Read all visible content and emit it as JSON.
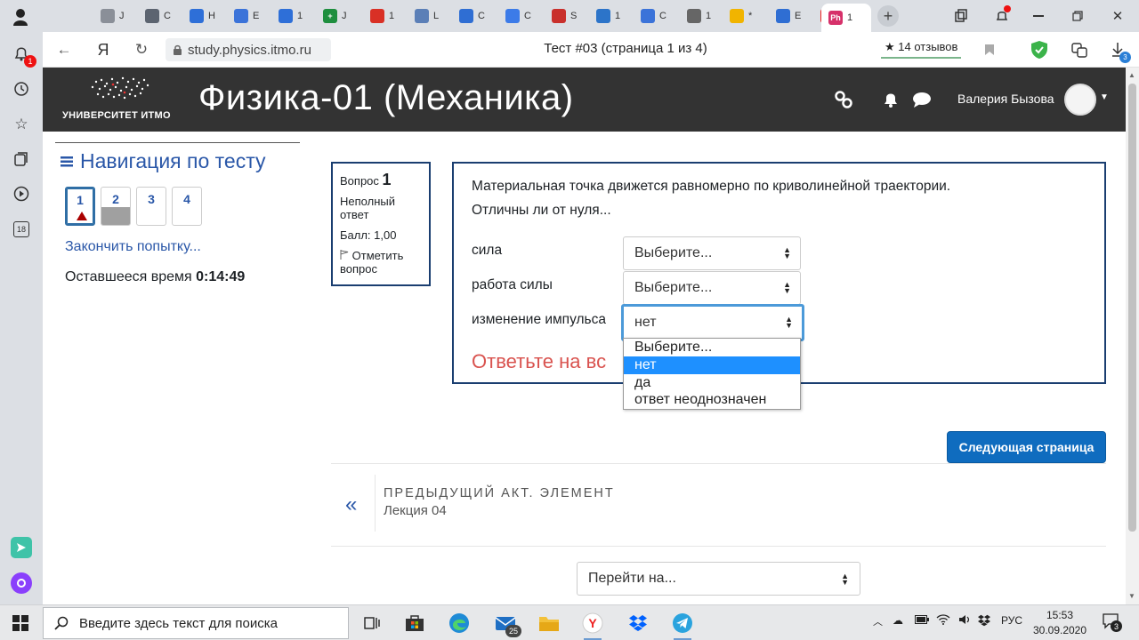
{
  "browser": {
    "tabs": [
      {
        "label": "",
        "fav_color": "#6b6b6b",
        "glyph": ""
      },
      {
        "label": "J",
        "fav_color": "#8a8f98",
        "glyph": ""
      },
      {
        "label": "C",
        "fav_color": "#5c6470",
        "glyph": ""
      },
      {
        "label": "H",
        "fav_color": "#2e6fd8",
        "glyph": ""
      },
      {
        "label": "E",
        "fav_color": "#3b73d9",
        "glyph": ""
      },
      {
        "label": "1",
        "fav_color": "#2e6fd8",
        "glyph": ""
      },
      {
        "label": "J",
        "fav_color": "#1e8e3e",
        "glyph": "+"
      },
      {
        "label": "1",
        "fav_color": "#d93025",
        "glyph": ""
      },
      {
        "label": "L",
        "fav_color": "#5b7fb7",
        "glyph": ""
      },
      {
        "label": "C",
        "fav_color": "#2f6ed3",
        "glyph": ""
      },
      {
        "label": "C",
        "fav_color": "#3c7be8",
        "glyph": ""
      },
      {
        "label": "S",
        "fav_color": "#c9302c",
        "glyph": ""
      },
      {
        "label": "1",
        "fav_color": "#2c74c9",
        "glyph": ""
      },
      {
        "label": "C",
        "fav_color": "#3b73d9",
        "glyph": ""
      },
      {
        "label": "1",
        "fav_color": "#666666",
        "glyph": ""
      },
      {
        "label": "*",
        "fav_color": "#f1b400",
        "glyph": ""
      },
      {
        "label": "E",
        "fav_color": "#2f6ed3",
        "glyph": ""
      },
      {
        "label": "F",
        "fav_color": "#e22",
        "glyph": "Я"
      },
      {
        "label": "1",
        "fav_color": "#d6316a",
        "glyph": "Ph"
      }
    ],
    "url": "study.physics.itmo.ru",
    "page_title": "Тест #03 (страница 1 из 4)",
    "reviews": "★ 14 отзывов",
    "download_badge": "3"
  },
  "sidepanel": {
    "notif_badge": "1",
    "calendar": "18"
  },
  "site": {
    "logo_text": "УНИВЕРСИТЕТ ИТМО",
    "course_title": "Физика-01 (Механика)",
    "user_name": "Валерия Бызова"
  },
  "quiz_nav": {
    "heading": "Навигация по тесту",
    "questions": [
      "1",
      "2",
      "3",
      "4"
    ],
    "finish_link": "Закончить попытку...",
    "time_label": "Оставшееся время ",
    "time_value": "0:14:49"
  },
  "question_info": {
    "label": "Вопрос ",
    "number": "1",
    "status": "Неполный ответ",
    "grade": "Балл: 1,00",
    "flag_label": "Отметить вопрос"
  },
  "question": {
    "line1": "Материальная точка движется равномерно по криволинейной траектории.",
    "line2": "Отличны ли от нуля...",
    "items": [
      {
        "label": "сила",
        "value": "Выберите..."
      },
      {
        "label": "работа силы",
        "value": "Выберите..."
      },
      {
        "label": "изменение импульса",
        "value": "нет"
      }
    ],
    "warning": "Ответьте на вс",
    "dropdown_options": [
      "Выберите...",
      "нет",
      "да",
      "ответ неоднозначен"
    ]
  },
  "actions": {
    "next_button": "Следующая страница",
    "prev_title": "ПРЕДЫДУЩИЙ АКТ. ЭЛЕМЕНТ",
    "prev_name": "Лекция 04",
    "jump_placeholder": "Перейти на..."
  },
  "taskbar": {
    "search_placeholder": "Введите здесь текст для поиска",
    "mail_badge": "25",
    "lang": "РУС",
    "time": "15:53",
    "date": "30.09.2020",
    "notif_count": "3"
  }
}
